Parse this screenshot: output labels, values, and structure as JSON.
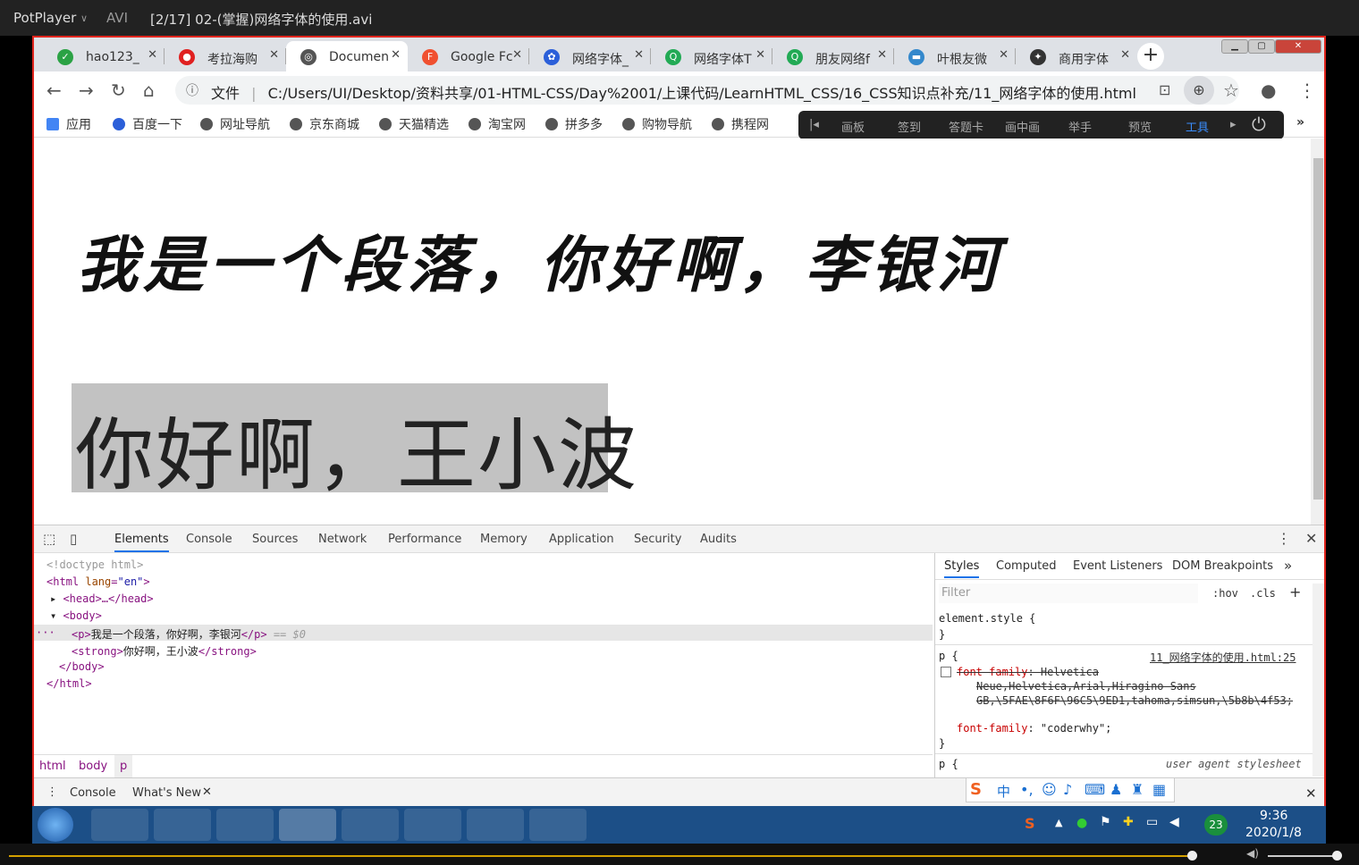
{
  "player": {
    "name": "PotPlayer",
    "dropdown": "∨",
    "format": "AVI",
    "file": "[2/17] 02-(掌握)网络字体的使用.avi"
  },
  "tabs": [
    {
      "label": "hao123_",
      "icon_color": "#2ba245",
      "icon": "check-icon"
    },
    {
      "label": "考拉海购",
      "icon_color": "#e02020",
      "icon": "koala-icon"
    },
    {
      "label": "Documen",
      "icon_color": "#555555",
      "icon": "globe-icon"
    },
    {
      "label": "Google Fc",
      "icon_color": "#f05030",
      "icon": "google-fonts-icon"
    },
    {
      "label": "网络字体_",
      "icon_color": "#2b5fd9",
      "icon": "baidu-icon"
    },
    {
      "label": "网络字体T",
      "icon_color": "#22aa55",
      "icon": "search-icon"
    },
    {
      "label": "朋友网络f",
      "icon_color": "#22aa55",
      "icon": "search-icon"
    },
    {
      "label": "叶根友微",
      "icon_color": "#3388cc",
      "icon": "font-site-icon"
    },
    {
      "label": "商用字体",
      "icon_color": "#333333",
      "icon": "font-site-icon"
    }
  ],
  "new_tab": "+",
  "address": {
    "secure_label": "文件",
    "url": "C:/Users/UI/Desktop/资料共享/01-HTML-CSS/Day%2001/上课代码/LearnHTML_CSS/16_CSS知识点补充/11_网络字体的使用.html"
  },
  "bookmarks": [
    "应用",
    "百度一下",
    "网址导航",
    "京东商城",
    "天猫精选",
    "淘宝网",
    "拼多多",
    "购物导航",
    "携程网"
  ],
  "overlay_toolbar": [
    "画板",
    "签到",
    "答题卡",
    "画中画",
    "举手",
    "预览",
    "工具"
  ],
  "page": {
    "paragraph": "我是一个段落，你好啊，李银河",
    "strong": "你好啊，王小波"
  },
  "devtools": {
    "tabs": [
      "Elements",
      "Console",
      "Sources",
      "Network",
      "Performance",
      "Memory",
      "Application",
      "Security",
      "Audits"
    ],
    "dom": {
      "doctype": "<!doctype html>",
      "html_open": "<html ",
      "html_attr": "lang",
      "html_val": "\"en\"",
      "head": "<head>…</head>",
      "body_open": "<body>",
      "p_open": "<p>",
      "p_text": "我是一个段落，你好啊，李银河",
      "p_close": "</p>",
      "p_marker": " == $0",
      "strong_open": "<strong>",
      "strong_text": "你好啊，王小波",
      "strong_close": "</strong>",
      "body_close": "</body>",
      "html_close": "</html>"
    },
    "breadcrumbs": [
      "html",
      "body",
      "p"
    ],
    "style_tabs": [
      "Styles",
      "Computed",
      "Event Listeners",
      "DOM Breakpoints"
    ],
    "filter_placeholder": "Filter",
    "hov": ":hov",
    "cls": ".cls",
    "element_style": "element.style {",
    "close_brace": "}",
    "rule_selector": "p {",
    "rule_source": "11_网络字体的使用.html:25",
    "struck_prop": "font-family",
    "struck_value_1": ": Helvetica",
    "struck_value_2": "Neue,Helvetica,Arial,Hiragino Sans",
    "struck_value_3": "GB,\\5FAE\\8F6F\\96C5\\9ED1,tahoma,simsun,\\5b8b\\4f53;",
    "active_prop": "font-family",
    "active_value": ": \"coderwhy\";",
    "ua_selector": "p {",
    "ua_source": "user agent stylesheet",
    "drawer_tabs": [
      "Console",
      "What's New"
    ]
  },
  "clock": {
    "time": "9:36",
    "date": "2020/1/8"
  },
  "tray_badge": "23",
  "colors": {
    "accent": "#1a73e8",
    "browser_border": "#e0251d",
    "taskbar": "#1c4f87",
    "seek": "#d4a000"
  }
}
